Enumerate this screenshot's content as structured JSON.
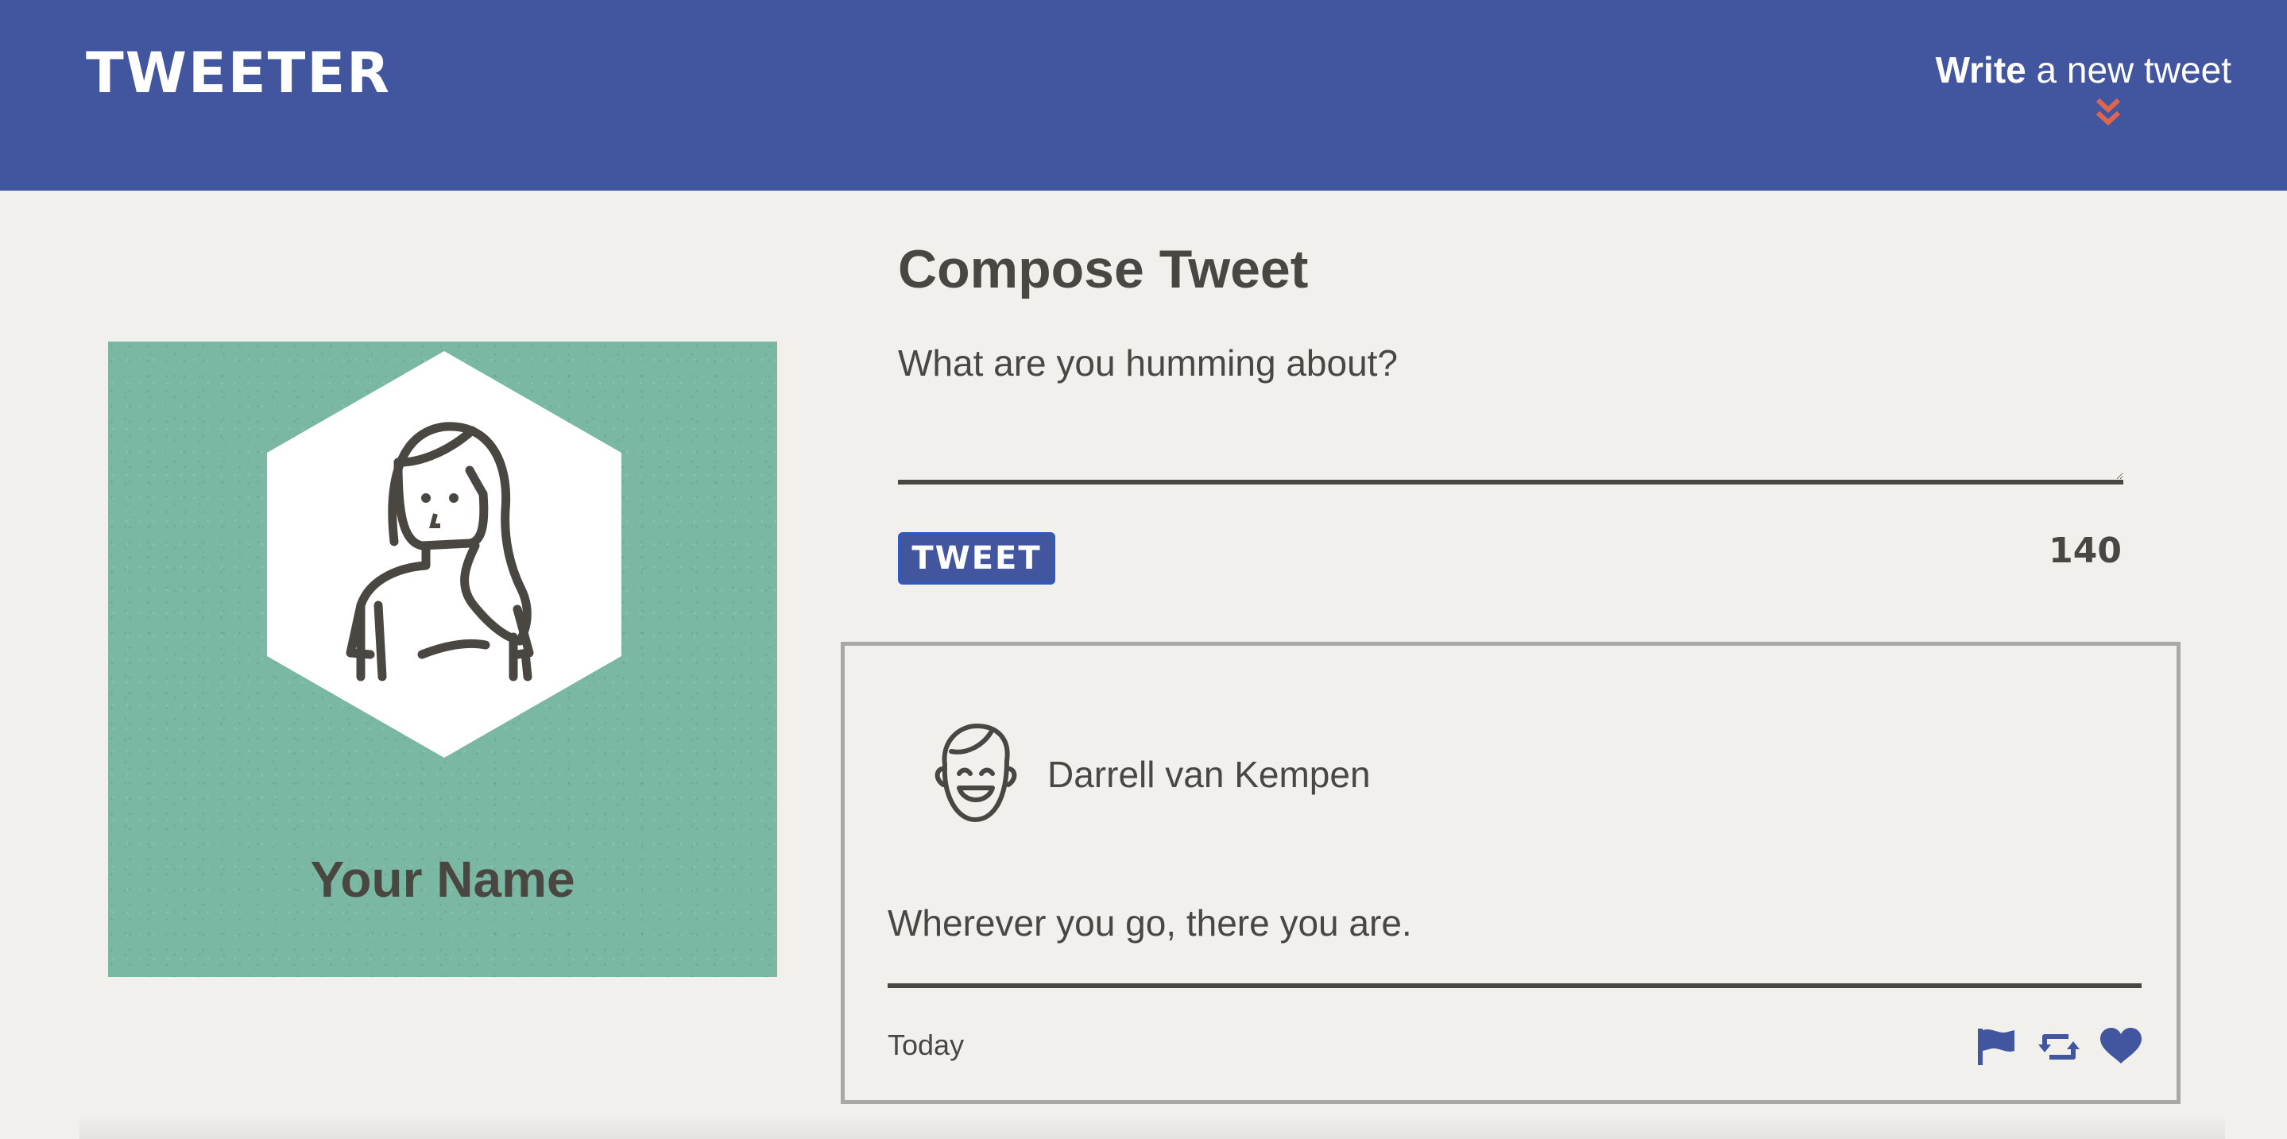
{
  "nav": {
    "brand": "TWEETER",
    "write_bold": "Write",
    "write_rest": " a new tweet",
    "chevron_icon": "double-chevron-down-icon",
    "chevron_color": "#e0654f"
  },
  "profile": {
    "name": "Your Name",
    "avatar_icon": "woman-avatar-icon",
    "background_color": "#7ab8a3"
  },
  "compose": {
    "title": "Compose Tweet",
    "placeholder": "What are you humming about?",
    "value": "",
    "button_label": "TWEET",
    "char_count": "140"
  },
  "tweet": {
    "author": "Darrell van Kempen",
    "avatar_icon": "smiling-man-avatar-icon",
    "content": "Wherever you go, there you are.",
    "timestamp": "Today",
    "actions": [
      "flag-icon",
      "retweet-icon",
      "heart-icon"
    ]
  },
  "colors": {
    "nav_bg": "#4256a0",
    "page_bg": "#f1f0ec",
    "text": "#4a4743",
    "accent_blue": "#4256a0"
  }
}
